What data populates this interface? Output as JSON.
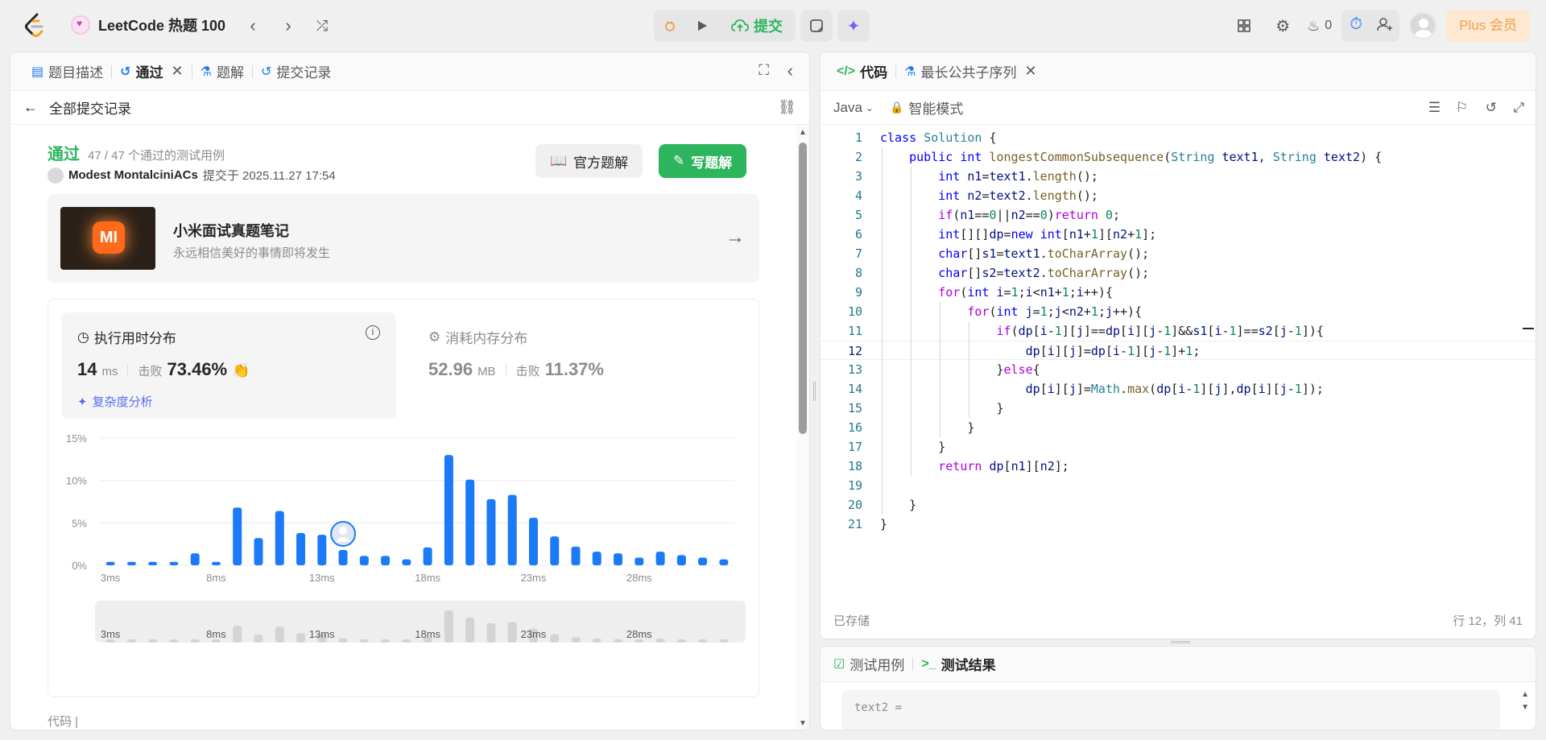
{
  "topbar": {
    "problem_list": "LeetCode 热题 100",
    "submit_label": "提交",
    "streak_count": "0",
    "plus_label": "Plus 会员"
  },
  "left": {
    "tabs": [
      {
        "label": "题目描述"
      },
      {
        "label": "通过"
      },
      {
        "label": "题解"
      },
      {
        "label": "提交记录"
      }
    ],
    "back_label": "全部提交记录",
    "status": "通过",
    "cases": "47 / 47 个通过的测试用例",
    "author": "Modest MontalciniACs",
    "submitted_at": "提交于 2025.11.27 17:54",
    "official_btn": "官方题解",
    "write_btn": "写题解",
    "ad_title": "小米面试真题笔记",
    "ad_sub": "永远相信美好的事情即将发生",
    "ad_logo": "MI",
    "runtime_title": "执行用时分布",
    "runtime_value": "14",
    "runtime_unit": "ms",
    "beat_label": "击败",
    "runtime_beat": "73.46%",
    "complexity_label": "复杂度分析",
    "memory_title": "消耗内存分布",
    "memory_value": "52.96",
    "memory_unit": "MB",
    "memory_beat": "11.37%",
    "cutoff_text": "代码 | "
  },
  "chart_data": {
    "type": "bar",
    "title": "",
    "xlabel": "",
    "ylabel": "",
    "ylim": [
      0,
      15
    ],
    "yticks": [
      "15%",
      "10%",
      "5%",
      "0%"
    ],
    "xtick_labels": [
      "3ms",
      "8ms",
      "13ms",
      "18ms",
      "23ms",
      "28ms"
    ],
    "categories": [
      3,
      4,
      5,
      6,
      7,
      8,
      9,
      10,
      11,
      12,
      13,
      14,
      15,
      16,
      17,
      18,
      19,
      20,
      21,
      22,
      23,
      24,
      25,
      26,
      27,
      28,
      29,
      30,
      31,
      32
    ],
    "values": [
      0.4,
      0.4,
      0.4,
      0.4,
      1.4,
      0.4,
      6.8,
      3.2,
      6.4,
      3.8,
      3.6,
      1.8,
      1.1,
      1.1,
      0.7,
      2.1,
      13.0,
      10.1,
      7.8,
      8.3,
      5.6,
      3.4,
      2.2,
      1.6,
      1.4,
      0.9,
      1.6,
      1.2,
      0.9,
      0.7
    ],
    "highlight_category": 14,
    "bar_color": "#1a7af8",
    "grid": true
  },
  "right": {
    "tab_code": "代码",
    "tab_problem": "最长公共子序列",
    "language": "Java",
    "mode": "智能模式",
    "saved": "已存储",
    "position": "行 12，列 41",
    "test_tab": "测试用例",
    "result_tab": "测试结果",
    "test_input": "text2 ="
  }
}
